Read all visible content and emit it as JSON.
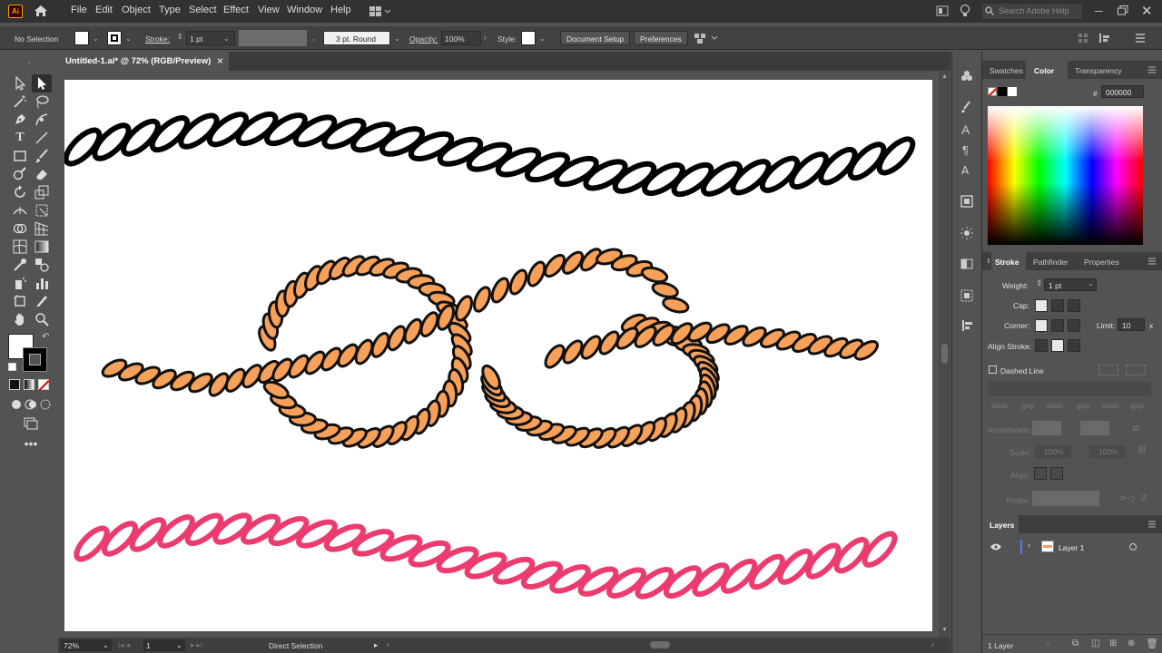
{
  "menubar": {
    "app_logo": "Ai",
    "items": [
      "File",
      "Edit",
      "Object",
      "Type",
      "Select",
      "Effect",
      "View",
      "Window",
      "Help"
    ],
    "search_placeholder": "Search Adobe Help"
  },
  "control_bar": {
    "selection": "No Selection",
    "stroke_label": "Stroke:",
    "stroke_weight": "1 pt",
    "brush": "3 pt. Round",
    "opacity_label": "Opacity:",
    "opacity_value": "100%",
    "style_label": "Style:",
    "document_setup": "Document Setup",
    "preferences": "Preferences"
  },
  "document": {
    "tab_title": "Untitled-1.ai* @ 72% (RGB/Preview)",
    "close": "×"
  },
  "artwork": {
    "rope1_color": "#000000",
    "rope2_fill": "#f6a05a",
    "rope2_glow": "#fff200",
    "rope3_color": "#ec3b6f"
  },
  "status_bar": {
    "zoom": "72%",
    "artboard": "1",
    "tool": "Direct Selection"
  },
  "color_panel": {
    "tabs": [
      "Swatches",
      "Color",
      "Transparency"
    ],
    "active_tab": "Color",
    "hex_label": "#",
    "hex_value": "000000"
  },
  "stroke_panel": {
    "tabs": [
      "Stroke",
      "Pathfinder",
      "Properties"
    ],
    "active_tab": "Stroke",
    "weight_label": "Weight:",
    "weight_value": "1 pt",
    "cap_label": "Cap:",
    "corner_label": "Corner:",
    "limit_label": "Limit:",
    "limit_value": "10",
    "limit_unit": "x",
    "align_label": "Align Stroke:",
    "dashed_label": "Dashed Line",
    "dash_labels": [
      "dash",
      "gap",
      "dash",
      "gap",
      "dash",
      "gap"
    ],
    "arrowheads_label": "Arrowheads:",
    "scale_label": "Scale:",
    "scale_values": [
      "100%",
      "100%"
    ],
    "align_arrow_label": "Align:",
    "profile_label": "Profile:"
  },
  "layers_panel": {
    "title": "Layers",
    "layer_name": "Layer 1",
    "footer": "1 Layer"
  }
}
